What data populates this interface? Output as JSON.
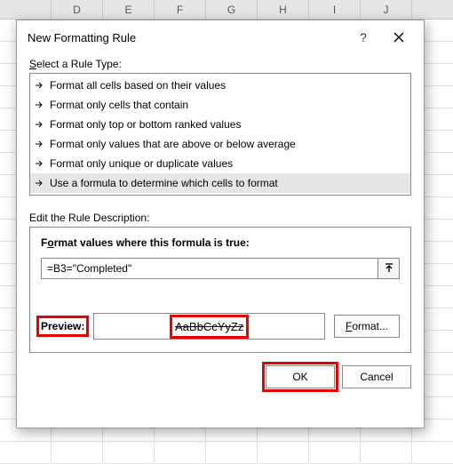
{
  "columns": [
    "D",
    "E",
    "F",
    "G",
    "H",
    "I",
    "J"
  ],
  "dialog": {
    "title": "New Formatting Rule",
    "help_symbol": "?",
    "select_label_pre": "S",
    "select_label_rest": "elect a Rule Type:",
    "rules": [
      "Format all cells based on their values",
      "Format only cells that contain",
      "Format only top or bottom ranked values",
      "Format only values that are above or below average",
      "Format only unique or duplicate values",
      "Use a formula to determine which cells to format"
    ],
    "selected_rule_index": 5,
    "edit_label": "Edit the Rule Description:",
    "formula_label_pre": "F",
    "formula_label_u": "o",
    "formula_label_rest": "rmat values where this formula is true:",
    "formula_value": "=B3=\"Completed\"",
    "preview_label": "Preview:",
    "preview_text": "AaBbCcYyZz",
    "format_btn_u": "F",
    "format_btn_rest": "ormat...",
    "ok_label": "OK",
    "cancel_label": "Cancel"
  }
}
